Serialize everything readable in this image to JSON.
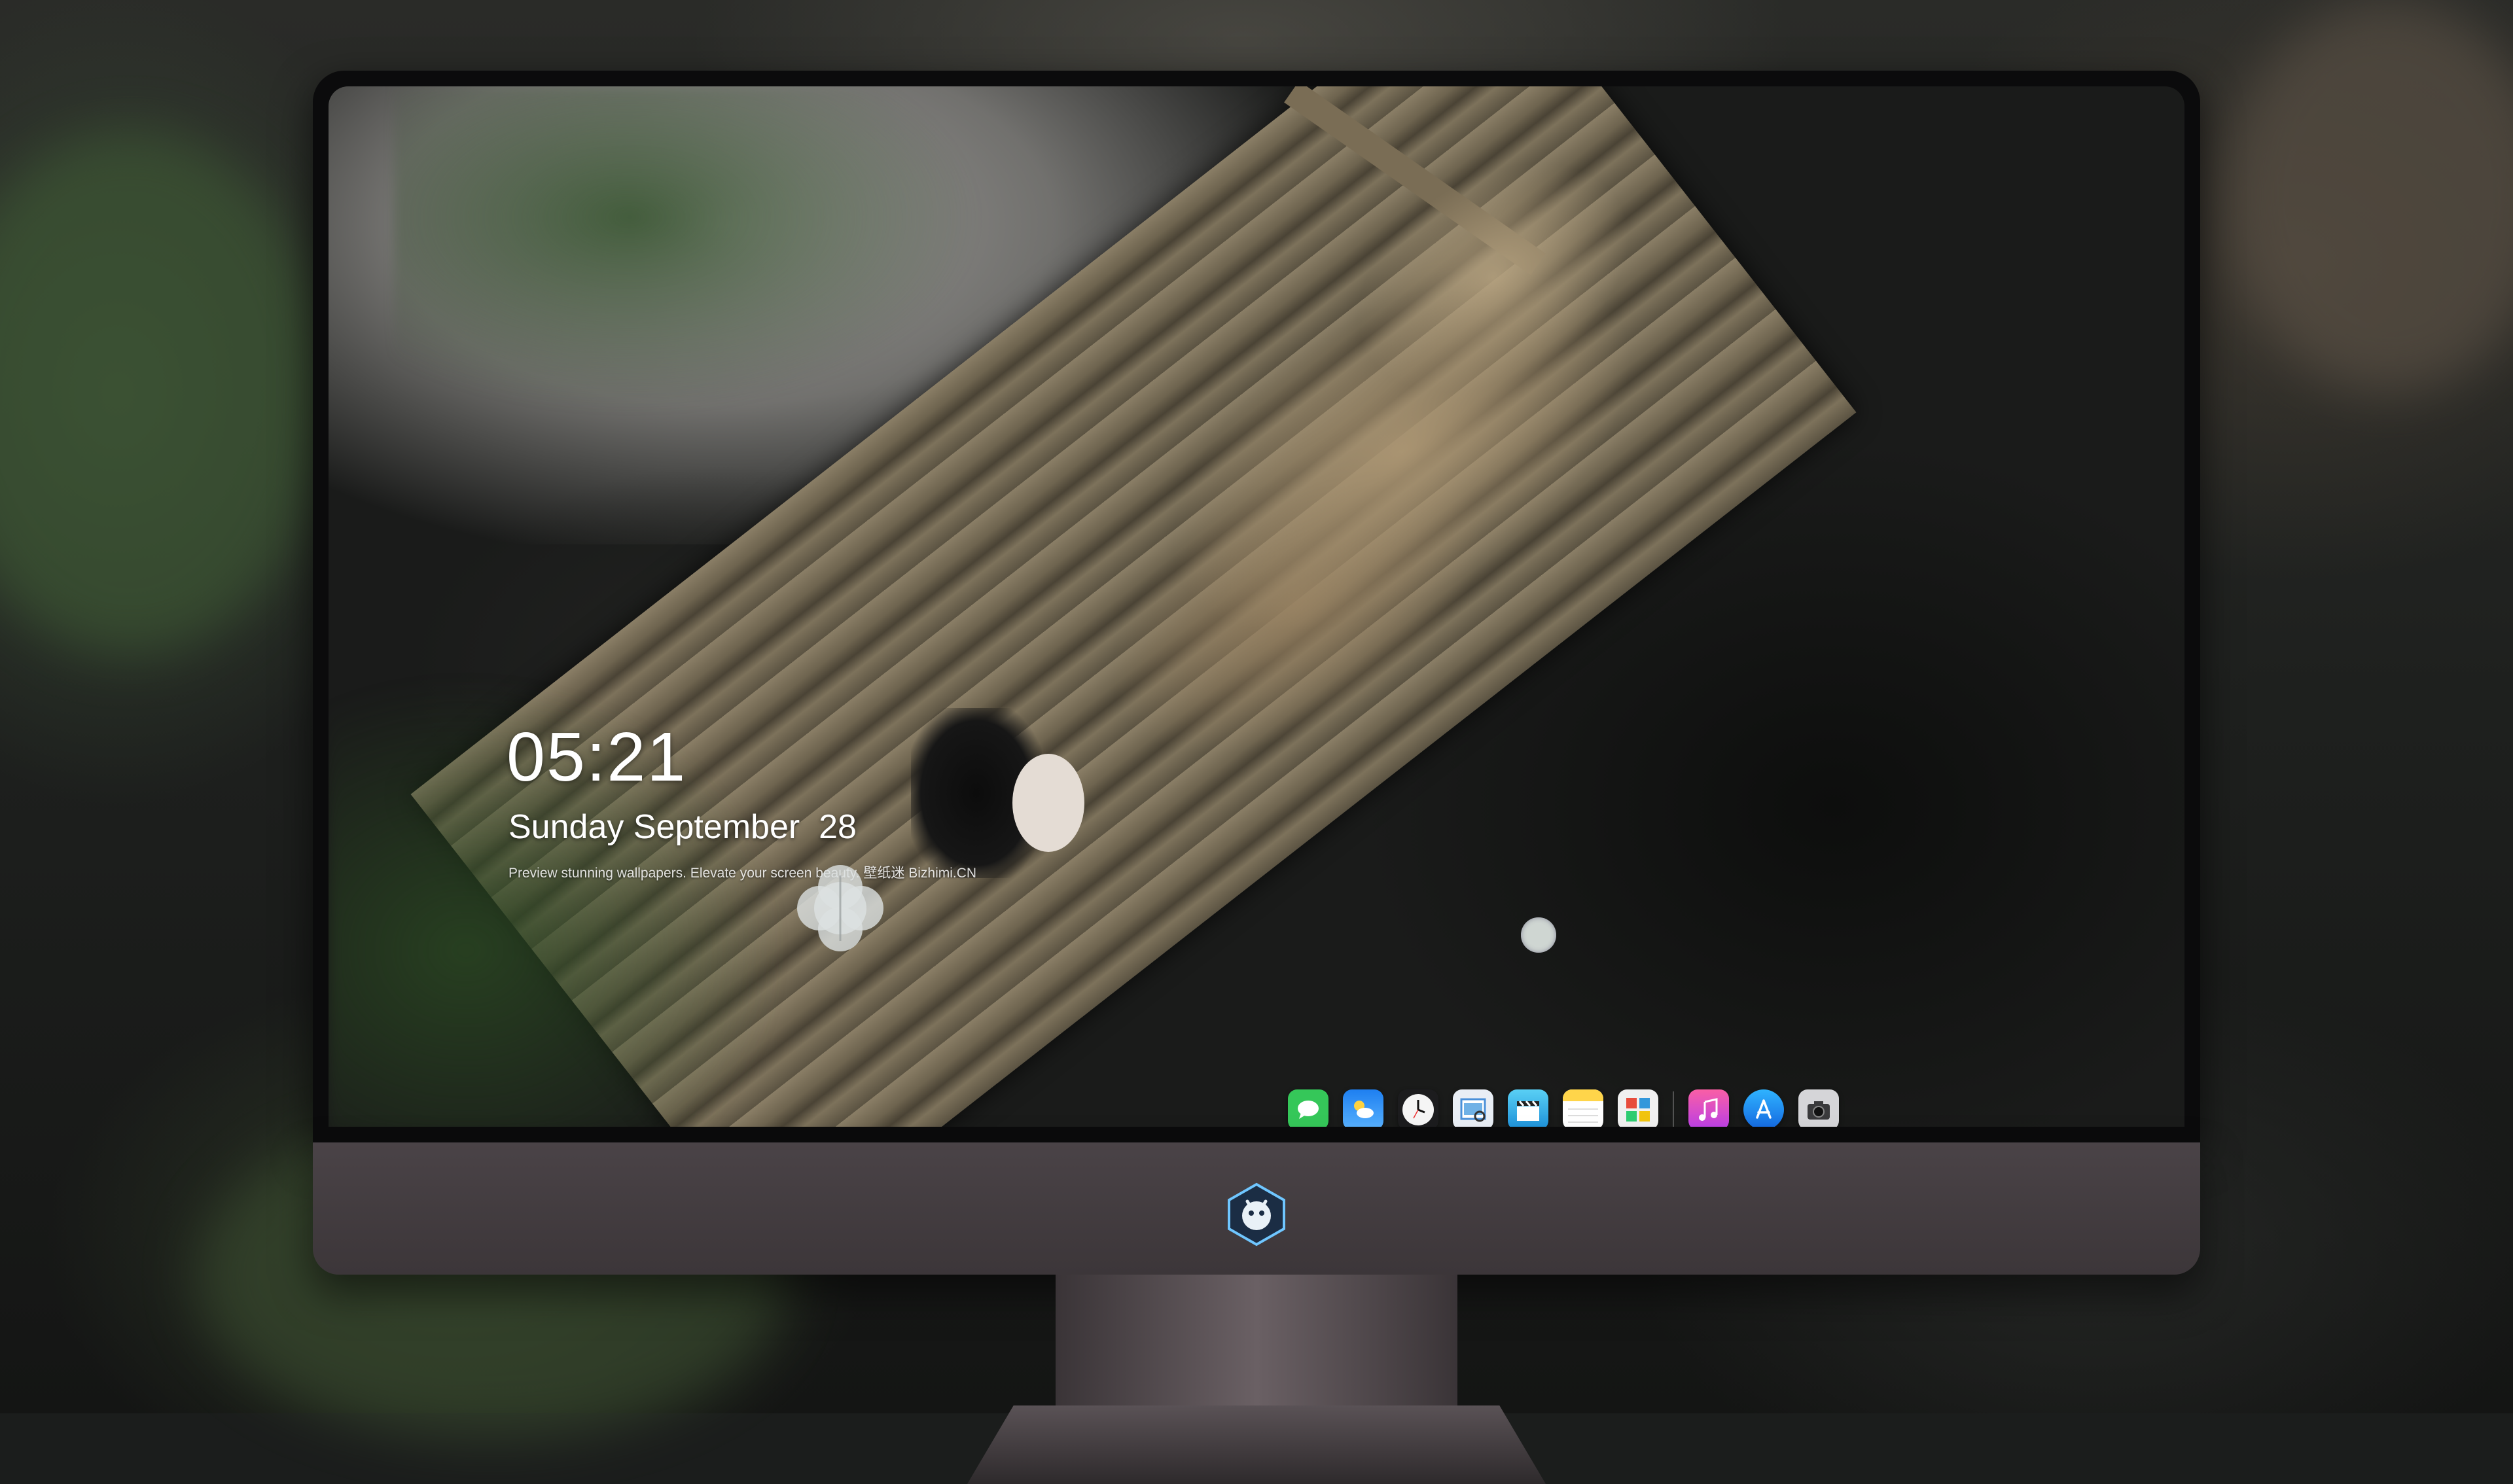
{
  "lock_screen": {
    "time": "05:21",
    "date": "Sunday September  28",
    "tagline": "Preview stunning wallpapers. Elevate your screen beauty. 壁纸迷 Bizhimi.CN"
  },
  "dock": {
    "apps": [
      {
        "name": "messages-icon",
        "color": "#35c759"
      },
      {
        "name": "weather-icon",
        "color": "#2f8df0"
      },
      {
        "name": "clock-icon",
        "color": "#f2f2f2"
      },
      {
        "name": "preview-icon",
        "color": "#4a90d9"
      },
      {
        "name": "claquette-icon",
        "color": "#2fb4e8"
      },
      {
        "name": "notes-icon",
        "color": "#ffd54a"
      },
      {
        "name": "photo-booth-icon",
        "color": "#e8e8e8"
      }
    ],
    "pinned": [
      {
        "name": "music-icon",
        "color": "#f43f8e"
      },
      {
        "name": "app-store-icon",
        "color": "#1d8ff2"
      },
      {
        "name": "camera-icon",
        "color": "#8e8e93"
      }
    ]
  }
}
